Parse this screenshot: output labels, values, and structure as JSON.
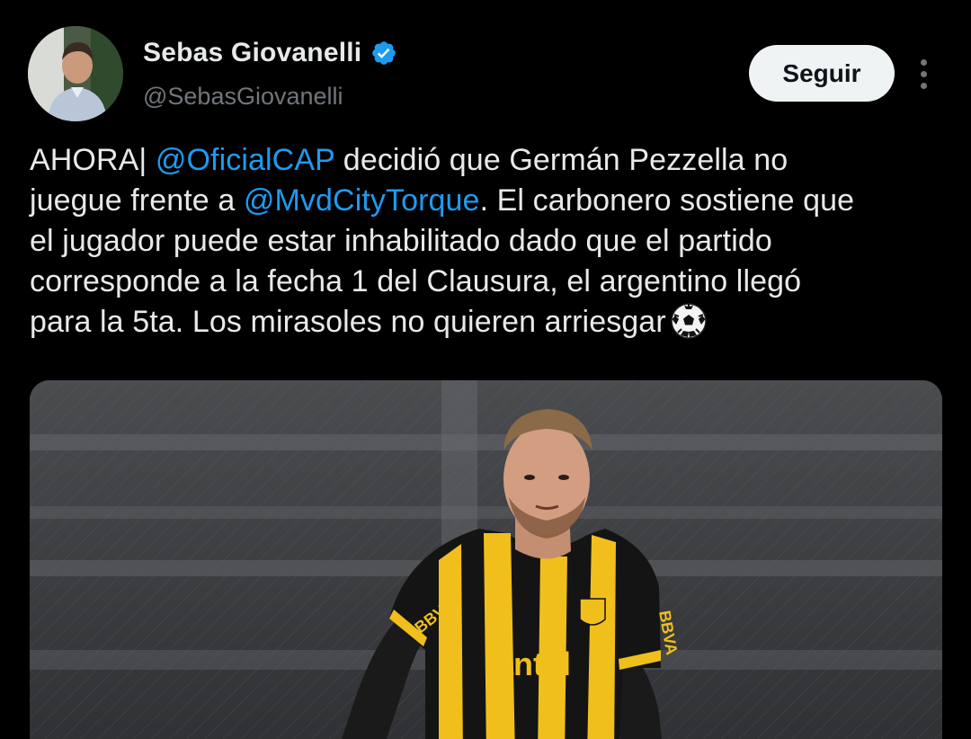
{
  "author": {
    "display_name": "Sebas Giovanelli",
    "handle": "@SebasGiovanelli",
    "verified": true,
    "avatar_icon": "profile-photo"
  },
  "actions": {
    "follow_label": "Seguir",
    "more_icon": "more-vertical-icon"
  },
  "tweet": {
    "lines": [
      [
        "AHORA| ",
        "@OficialCAP",
        " decidió que Germán Pezzella no"
      ],
      [
        "juegue frente a ",
        "@MvdCityTorque",
        ". El carbonero sostiene que"
      ],
      [
        "el jugador puede estar inhabilitado dado que el partido"
      ],
      [
        "corresponde a la fecha 1 del Clausura, el argentino llegó"
      ],
      [
        "para la 5ta. Los mirasoles no quieren arriesgar"
      ]
    ],
    "emoji": "soccer-ball",
    "media": {
      "shirt_text": "antel",
      "sleeve_text": "BBVA",
      "description_icon": "player-photo"
    }
  },
  "colors": {
    "background": "#000000",
    "text": "#e7e9ea",
    "muted": "#71767b",
    "mention": "#1d9bf0",
    "follow_bg": "#eff3f4",
    "verified": "#1d9bf0"
  }
}
